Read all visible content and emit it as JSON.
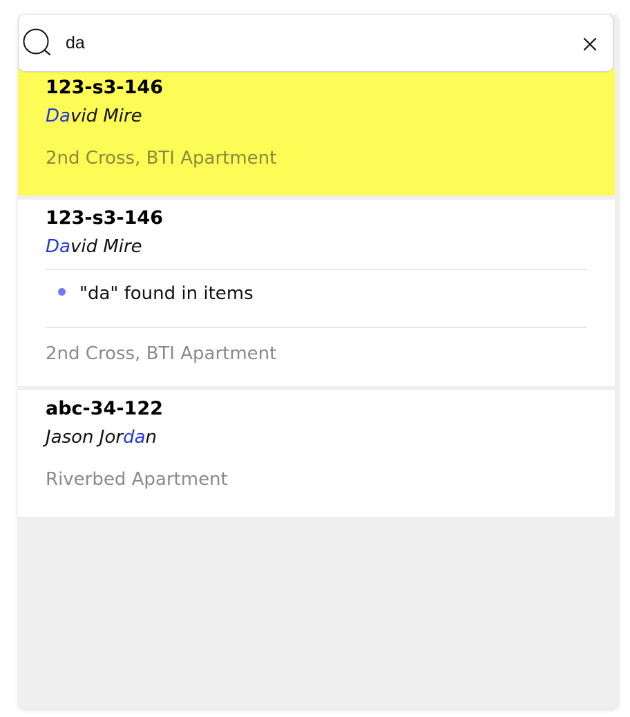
{
  "search": {
    "value": "da",
    "icon": "search-icon",
    "clear_icon": "close-icon"
  },
  "colors": {
    "highlight_background": "#fdfc57",
    "match_text": "#2136d9",
    "bullet": "#6c7df0",
    "secondary_text": "#8a8a8a"
  },
  "results": [
    {
      "id": "123-s3-146",
      "name_match": "Da",
      "name_rest": "vid Mire",
      "address": "2nd Cross, BTI Apartment",
      "highlighted": true
    },
    {
      "id": "123-s3-146",
      "name_match": "Da",
      "name_rest": "vid Mire",
      "match_note": "\"da\" found in items",
      "address": "2nd Cross, BTI Apartment",
      "highlighted": false
    },
    {
      "id": "abc-34-122",
      "name_before": "Jason Jor",
      "name_match": "da",
      "name_after": "n",
      "address": "Riverbed Apartment",
      "highlighted": false
    }
  ]
}
